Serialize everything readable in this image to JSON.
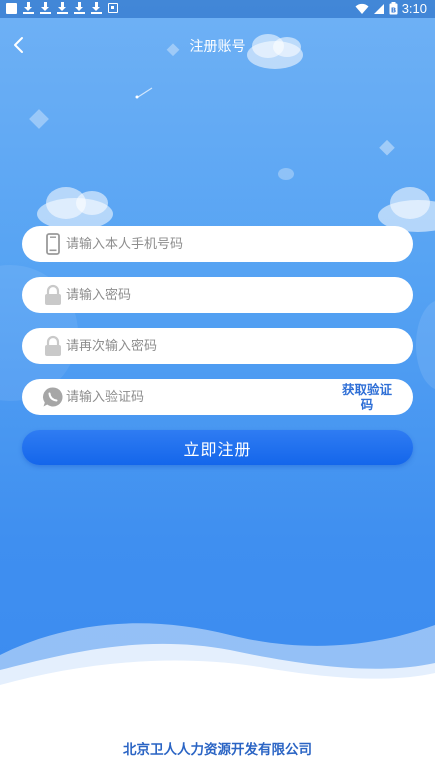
{
  "status_bar": {
    "time": "3:10",
    "battery_label": "B",
    "icons": [
      "white-square-icon",
      "download-icon",
      "download-icon",
      "download-icon",
      "download-icon",
      "download-icon",
      "image-icon",
      "wifi-icon",
      "signal-icon",
      "battery-icon"
    ]
  },
  "header": {
    "title": "注册账号",
    "back_icon": "chevron-left-icon"
  },
  "form": {
    "phone": {
      "placeholder": "请输入本人手机号码",
      "value": "",
      "icon": "phone-icon"
    },
    "password": {
      "placeholder": "请输入密码",
      "value": "",
      "icon": "lock-icon"
    },
    "password_confirm": {
      "placeholder": "请再次输入密码",
      "value": "",
      "icon": "lock-icon"
    },
    "verify_code": {
      "placeholder": "请输入验证码",
      "value": "",
      "icon": "chat-bubble-icon",
      "get_code_label": "获取验证码"
    }
  },
  "submit_label": "立即注册",
  "footer": {
    "company": "北京卫人人力资源开发有限公司"
  },
  "colors": {
    "background_top": "#6fb1f5",
    "background_bottom": "#3a8aef",
    "button": "#1466eb",
    "link": "#2f6fd6",
    "company_text": "#2a64c4"
  }
}
